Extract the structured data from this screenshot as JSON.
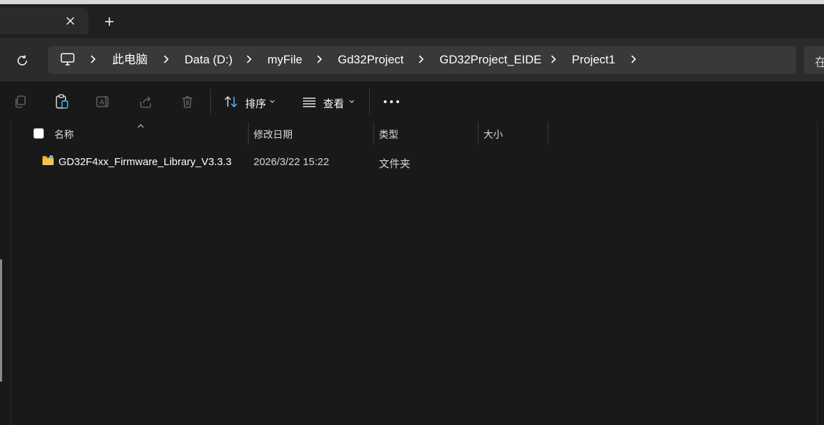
{
  "tab": {
    "close_icon": "close-icon",
    "new_tab_icon": "plus-icon"
  },
  "address": {
    "refresh_icon": "refresh-icon",
    "pc_icon": "monitor-icon",
    "crumbs": [
      "此电脑",
      "Data (D:)",
      "myFile",
      "Gd32Project",
      "GD32Project_EIDE",
      "Project1"
    ],
    "search_placeholder": "在"
  },
  "toolbar": {
    "copy_icon": "copy-icon",
    "paste_icon": "paste-icon",
    "rename_icon": "rename-icon",
    "share_icon": "share-icon",
    "delete_icon": "trash-icon",
    "sort_label": "排序",
    "view_label": "查看",
    "more_icon": "more-icon"
  },
  "columns": [
    "名称",
    "修改日期",
    "类型",
    "大小"
  ],
  "files": [
    {
      "name": "GD32F4xx_Firmware_Library_V3.3.3",
      "modified": "2026/3/22 15:22",
      "type": "文件夹",
      "size": ""
    }
  ],
  "colors": {
    "accent": "#4cc2ff",
    "folder": "#f5c24c"
  }
}
